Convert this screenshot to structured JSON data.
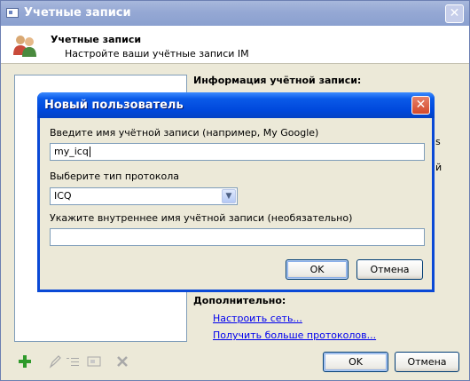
{
  "outer_window": {
    "title": "Учетные записи",
    "header_title": "Учетные записи",
    "header_subtitle": "Настройте ваши учётные записи IM",
    "info_heading": "Информация учётной записи:",
    "partial_text_1": "s",
    "partial_text_2": "й",
    "more_heading": "Дополнительно:",
    "links": [
      "Настроить сеть...",
      "Получить больше протоколов..."
    ],
    "toolbar_icons": [
      "add-icon",
      "edit-icon",
      "rename-icon",
      "properties-icon",
      "delete-icon"
    ],
    "ok_label": "OK",
    "cancel_label": "Отмена"
  },
  "dialog": {
    "title": "Новый пользователь",
    "account_name_label": "Введите имя учётной записи (например, My Google)",
    "account_name_value": "my_icq",
    "protocol_label": "Выберите тип протокола",
    "protocol_value": "ICQ",
    "internal_name_label": "Укажите внутреннее имя учётной записи (необязательно)",
    "internal_name_value": "",
    "ok_label": "OK",
    "cancel_label": "Отмена"
  },
  "colors": {
    "dialog_title": "#0048dc",
    "window_body": "#ece9d8",
    "link": "#0000ee"
  }
}
